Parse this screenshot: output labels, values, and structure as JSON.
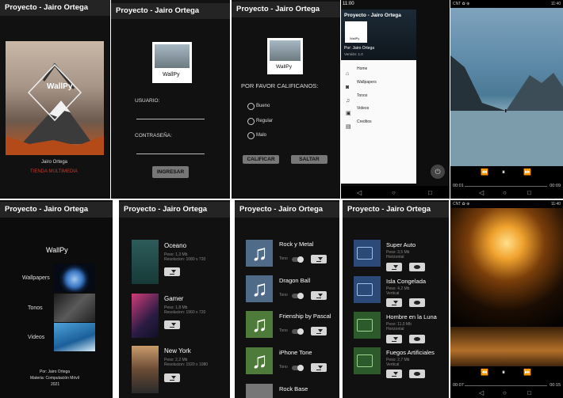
{
  "app_title": "Proyecto - Jairo Ortega",
  "splash": {
    "logo": "WallPy",
    "author": "Jairo Ortega",
    "subtitle": "TIENDA MULTIMEDIA"
  },
  "login": {
    "logo": "WallPy",
    "user_label": "USUARIO:",
    "pass_label": "CONTRASEÑA:",
    "submit": "INGRESAR"
  },
  "rating": {
    "logo": "WallPy",
    "prompt": "POR FAVOR CALIFICANOS:",
    "options": [
      "Bueno",
      "Regular",
      "Malo"
    ],
    "rate": "CALIFICAR",
    "skip": "SALTAR"
  },
  "drawer": {
    "status_time": "11:00",
    "logo": "WallPy",
    "author": "Por: Jairo Ortega",
    "version": "Versión: 1.0",
    "items": [
      "Home",
      "Wallpapers",
      "Tonos",
      "Videos",
      "Creditos"
    ]
  },
  "player1": {
    "status_left": "CNT ✿ ⊕",
    "status_right": "11:40",
    "time_start": "00:01",
    "time_end": "00:09"
  },
  "home": {
    "title": "WallPy",
    "sections": [
      "Wallpapers",
      "Tonos",
      "Videos"
    ],
    "footer": [
      "Por: Jairo Ortega",
      "Materia: Computación Móvil",
      "2021"
    ]
  },
  "wallpapers": [
    {
      "name": "Oceano",
      "size": "Peso:  1,3 Mb",
      "res": "Resolucion:  1080 x 720"
    },
    {
      "name": "Gamer",
      "size": "Peso:  1,8 Mb",
      "res": "Resolucion:  1960 x 720"
    },
    {
      "name": "New York",
      "size": "Peso:  2,2 Mb",
      "res": "Resolucion:  1920 x 1080"
    }
  ],
  "tones": {
    "toggle_label": "Tono",
    "items": [
      "Rock y Metal",
      "Dragon Ball",
      "Frienship by Pascal",
      "iPhone Tone",
      "Rock Base"
    ]
  },
  "videos": [
    {
      "name": "Super Auto",
      "size": "Peso: 3,5 Mb",
      "orient": "Horizontal"
    },
    {
      "name": "Isla Congelada",
      "size": "Peso: 4,2 Mb",
      "orient": "Vertical"
    },
    {
      "name": "Hombre en la Luna",
      "size": "Peso: 11,0 Mb",
      "orient": "Horizontal"
    },
    {
      "name": "Fuegos Artificiales",
      "size": "Peso: 2,7 Mb",
      "orient": "Vertical"
    }
  ],
  "player2": {
    "status_left": "CNT ✿ ⊕",
    "status_right": "11:40",
    "time_start": "00:07",
    "time_end": "00:15"
  },
  "colors": {
    "tone_thumb": "#d6d6d6",
    "tone_icon": "#4f6b88",
    "tone_green": "#4e7b3a",
    "video_blue": "#2b4a78",
    "video_green": "#2d5a2a",
    "accent_red": "#c0392b"
  }
}
